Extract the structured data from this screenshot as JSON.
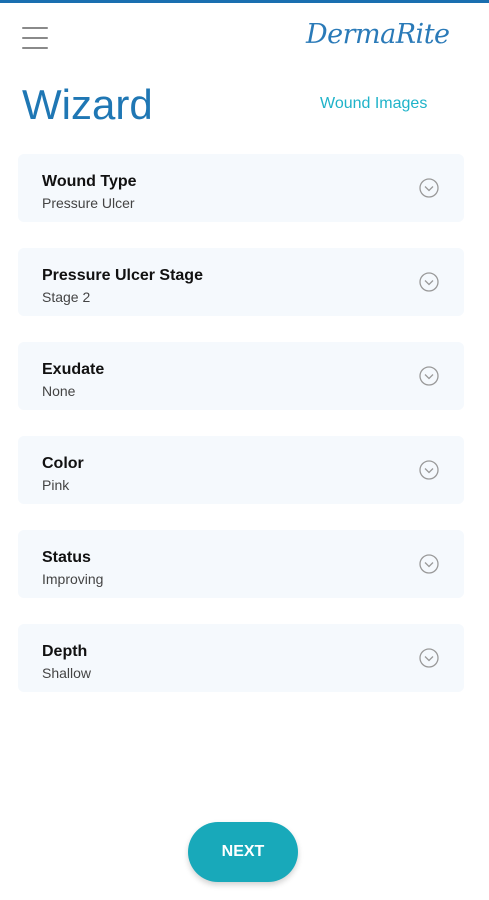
{
  "colors": {
    "brand_blue": "#1f77b4",
    "accent_teal": "#18a9ba",
    "link_teal": "#1fb3c9",
    "card_bg": "#f5f9fd"
  },
  "header": {
    "menu_icon": "hamburger-menu-icon",
    "logo_text": "DermaRite"
  },
  "page": {
    "title": "Wizard",
    "wound_images_link": "Wound Images"
  },
  "fields": [
    {
      "label": "Wound Type",
      "value": "Pressure Ulcer",
      "icon": "chevron-down-circle-icon"
    },
    {
      "label": "Pressure Ulcer Stage",
      "value": "Stage 2",
      "icon": "chevron-down-circle-icon"
    },
    {
      "label": "Exudate",
      "value": "None",
      "icon": "chevron-down-circle-icon"
    },
    {
      "label": "Color",
      "value": "Pink",
      "icon": "chevron-down-circle-icon"
    },
    {
      "label": "Status",
      "value": "Improving",
      "icon": "chevron-down-circle-icon"
    },
    {
      "label": "Depth",
      "value": "Shallow",
      "icon": "chevron-down-circle-icon"
    }
  ],
  "footer": {
    "next_label": "NEXT"
  }
}
